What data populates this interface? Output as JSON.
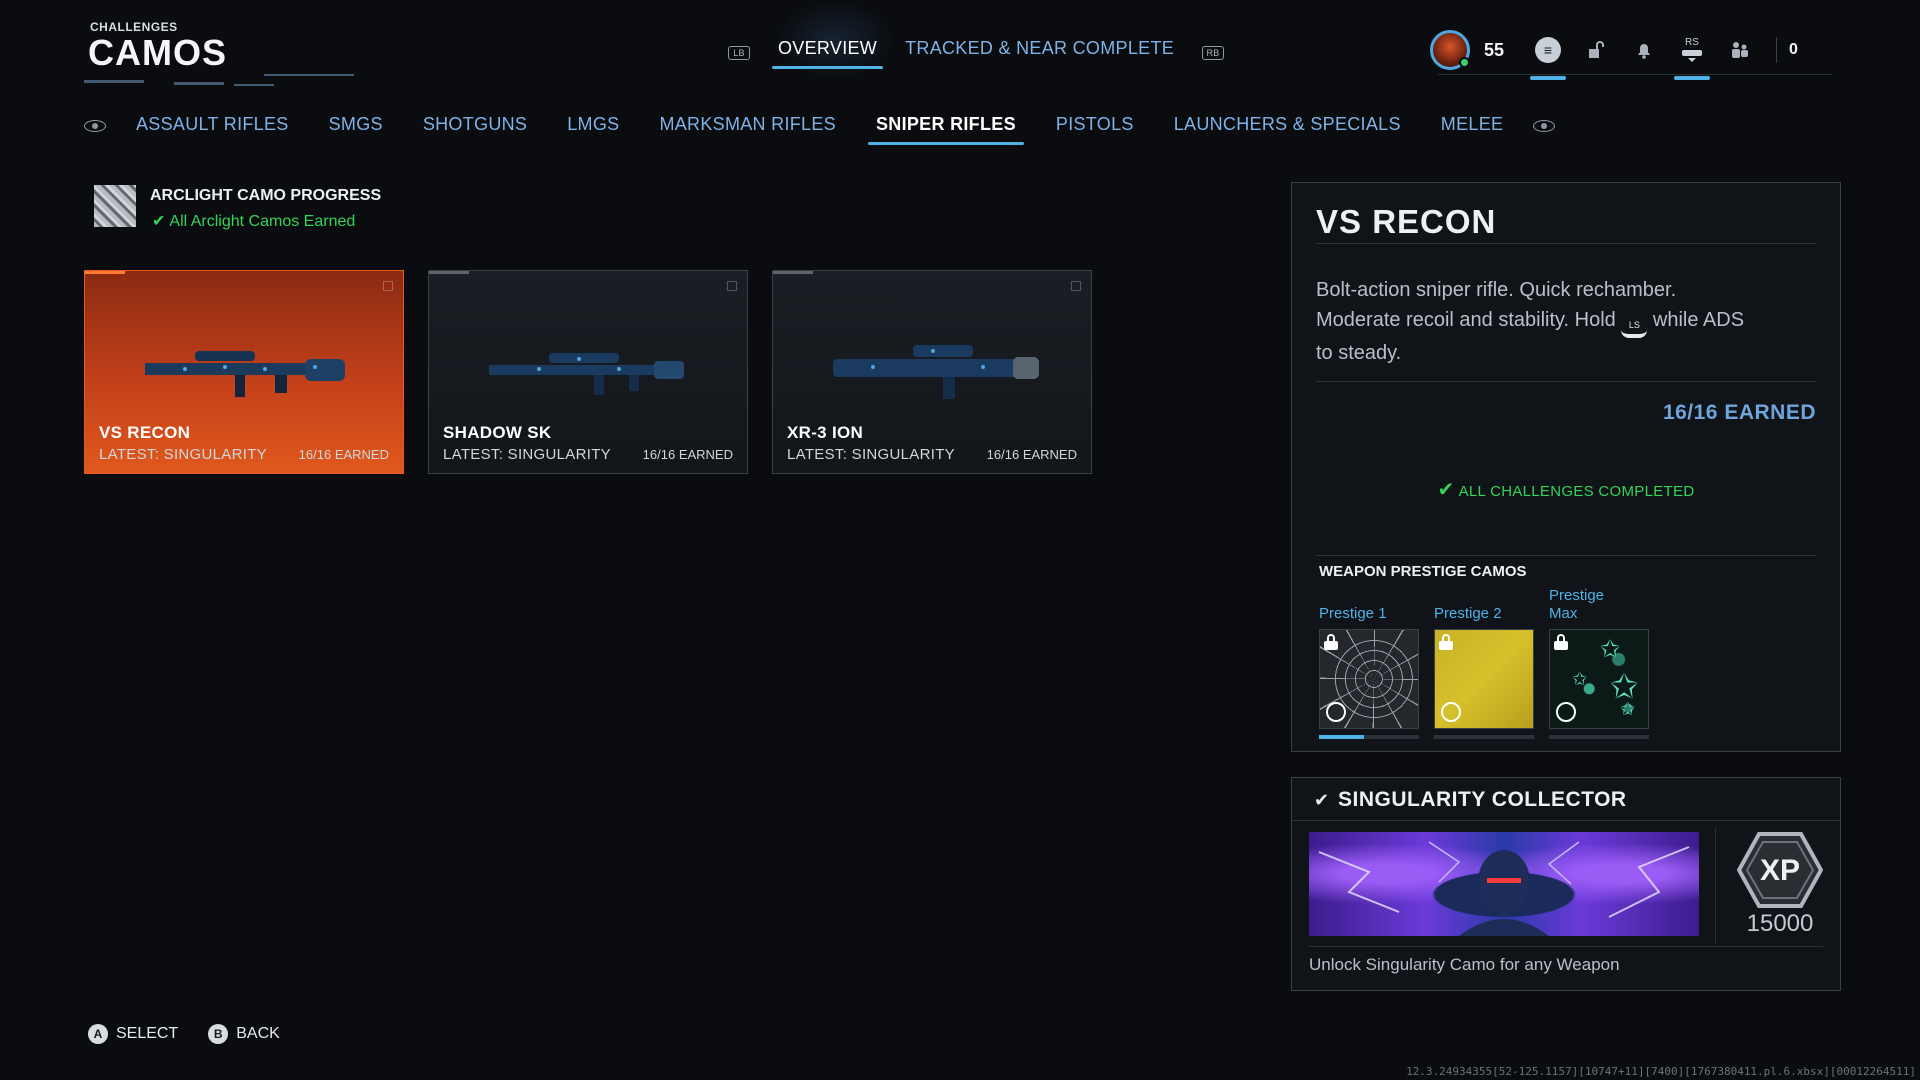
{
  "header": {
    "category": "CHALLENGES",
    "title": "CAMOS"
  },
  "topnav": {
    "left_bumper": "LB",
    "right_bumper": "RB",
    "tabs": [
      {
        "label": "OVERVIEW",
        "active": true
      },
      {
        "label": "TRACKED & NEAR COMPLETE",
        "active": false
      }
    ]
  },
  "status_bar": {
    "level": "55",
    "rs_label": "RS",
    "count": "0",
    "icons": [
      "avatar-icon",
      "menu-icon",
      "locker-icon",
      "notification-icon",
      "social-icon",
      "party-icon"
    ]
  },
  "categories": [
    {
      "label": "ASSAULT RIFLES",
      "active": false
    },
    {
      "label": "SMGS",
      "active": false
    },
    {
      "label": "SHOTGUNS",
      "active": false
    },
    {
      "label": "LMGS",
      "active": false
    },
    {
      "label": "MARKSMAN RIFLES",
      "active": false
    },
    {
      "label": "SNIPER RIFLES",
      "active": true
    },
    {
      "label": "PISTOLS",
      "active": false
    },
    {
      "label": "LAUNCHERS & SPECIALS",
      "active": false
    },
    {
      "label": "MELEE",
      "active": false
    }
  ],
  "arclight": {
    "title": "ARCLIGHT CAMO PROGRESS",
    "status": "All Arclight Camos Earned"
  },
  "weapons": [
    {
      "name": "VS RECON",
      "latest": "LATEST: SINGULARITY",
      "earned": "16/16 EARNED",
      "selected": true
    },
    {
      "name": "SHADOW SK",
      "latest": "LATEST: SINGULARITY",
      "earned": "16/16 EARNED",
      "selected": false
    },
    {
      "name": "XR-3 ION",
      "latest": "LATEST: SINGULARITY",
      "earned": "16/16 EARNED",
      "selected": false
    }
  ],
  "detail": {
    "title": "VS RECON",
    "desc_part1": "Bolt-action sniper rifle.  Quick rechamber.",
    "desc_part2": "Moderate recoil and stability.  Hold",
    "desc_button": "LS",
    "desc_part3": "while ADS",
    "desc_part4": "to steady.",
    "earned": "16/16 EARNED",
    "all_completed": "ALL CHALLENGES COMPLETED",
    "prestige_title": "WEAPON PRESTIGE CAMOS",
    "prestige": [
      {
        "label": "Prestige 1",
        "locked": true,
        "progress": 0.45
      },
      {
        "label": "Prestige 2",
        "locked": true,
        "progress": 0.0
      },
      {
        "label": "Prestige Max",
        "locked": true,
        "progress": 0.0
      }
    ]
  },
  "challenge": {
    "title": "SINGULARITY COLLECTOR",
    "xp_label": "XP",
    "xp_value": "15000",
    "description": "Unlock Singularity Camo for any Weapon"
  },
  "footer": {
    "select_glyph": "A",
    "select_label": "SELECT",
    "back_glyph": "B",
    "back_label": "BACK"
  },
  "build_string": "12.3.24934355[52-125.1157][10747+11][7400][1767380411.pl.6.xbsx][00012264511]",
  "colors": {
    "accent": "#4fb3e8",
    "selected_card": "#e0581c",
    "success": "#34d35a",
    "earned": "#6fa4dc"
  }
}
